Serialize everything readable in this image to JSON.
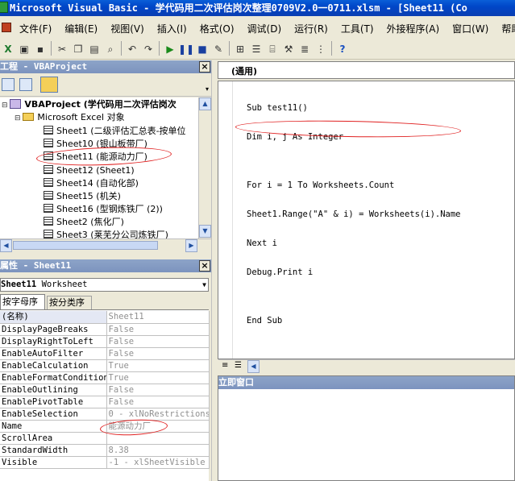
{
  "window": {
    "title": "Microsoft Visual Basic - 学代码用二次评估岗次整理0709V2.0一0711.xlsm - [Sheet11 (Co"
  },
  "menu": [
    "文件(F)",
    "编辑(E)",
    "视图(V)",
    "插入(I)",
    "格式(O)",
    "调试(D)",
    "运行(R)",
    "工具(T)",
    "外接程序(A)",
    "窗口(W)",
    "帮助"
  ],
  "project_pane": {
    "title": "工程 - VBAProject",
    "project_label": "VBAProject (学代码用二次评估岗次",
    "folder_label": "Microsoft Excel 对象",
    "items": [
      "Sheet1 (二级评估汇总表-按单位",
      "Sheet10 (银山板带厂)",
      "Sheet11 (能源动力厂)",
      "Sheet12 (Sheet1)",
      "Sheet14 (自动化部)",
      "Sheet15 (机关)",
      "Sheet16 (型钢炼铁厂 (2))",
      "Sheet2 (焦化厂)",
      "Sheet3 (莱芜分公司炼铁厂)"
    ]
  },
  "properties_pane": {
    "title": "属性 - Sheet11",
    "object_name": "Sheet11",
    "object_type": "Worksheet",
    "tabs": [
      "按字母序",
      "按分类序"
    ],
    "rows": [
      {
        "name": "(名称)",
        "value": "Sheet11"
      },
      {
        "name": "DisplayPageBreaks",
        "value": "False"
      },
      {
        "name": "DisplayRightToLeft",
        "value": "False"
      },
      {
        "name": "EnableAutoFilter",
        "value": "False"
      },
      {
        "name": "EnableCalculation",
        "value": "True"
      },
      {
        "name": "EnableFormatConditions",
        "value": "True"
      },
      {
        "name": "EnableOutlining",
        "value": "False"
      },
      {
        "name": "EnablePivotTable",
        "value": "False"
      },
      {
        "name": "EnableSelection",
        "value": "0 - xlNoRestrictions"
      },
      {
        "name": "Name",
        "value": "能源动力厂"
      },
      {
        "name": "ScrollArea",
        "value": ""
      },
      {
        "name": "StandardWidth",
        "value": "8.38"
      },
      {
        "name": "Visible",
        "value": "-1 - xlSheetVisible"
      }
    ]
  },
  "code_window": {
    "object_combo": "(通用)",
    "lines": [
      "Sub test11()",
      "Dim i, j As Integer",
      "",
      "For i = 1 To Worksheets.Count",
      "Sheet1.Range(\"A\" & i) = Worksheets(i).Name",
      "Next i",
      "Debug.Print i",
      "",
      "End Sub"
    ]
  },
  "immediate": {
    "title": "立即窗口"
  },
  "colors": {
    "title_bar": "#0a5fd8",
    "pane_header": "#8da4c8",
    "annotation_red": "#e02020"
  }
}
